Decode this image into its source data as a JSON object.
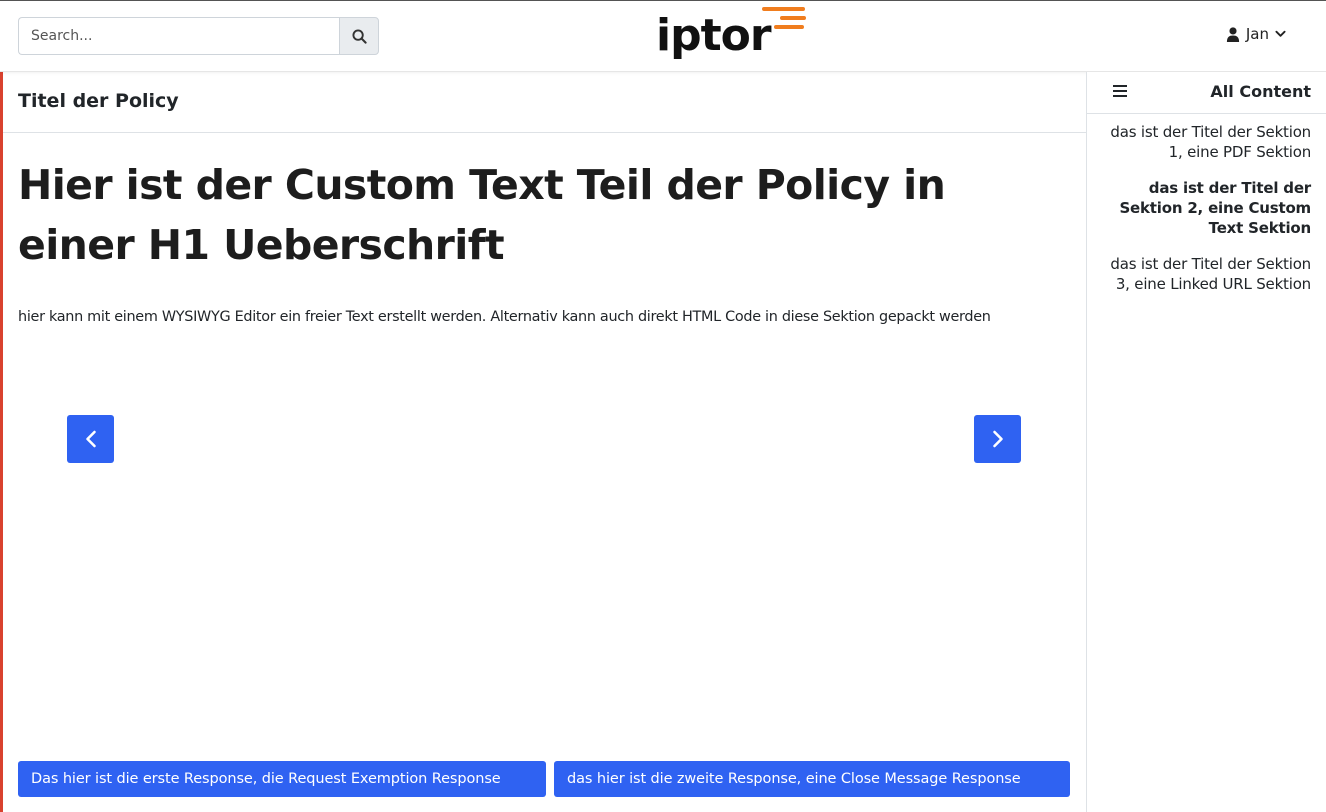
{
  "header": {
    "search_placeholder": "Search...",
    "logo_text": "iptor",
    "user_name": "Jan"
  },
  "main": {
    "policy_title": "Titel der Policy",
    "heading": "Hier ist der Custom Text Teil der Policy in einer H1 Ueberschrift",
    "body": "hier kann mit einem WYSIWYG Editor ein freier Text erstellt werden. Alternativ kann auch direkt HTML Code in diese Sektion gepackt werden",
    "responses": [
      "Das hier ist die erste Response, die Request Exemption Response",
      "das hier ist die zweite Response, eine Close Message Response"
    ]
  },
  "sidebar": {
    "title": "All Content",
    "items": [
      "das ist der Titel der Sektion 1, eine PDF Sektion",
      "das ist der Titel der Sektion 2, eine Custom Text Sektion",
      "das ist der Titel der Sektion 3, eine Linked URL Sektion"
    ],
    "active_index": 1
  },
  "colors": {
    "primary": "#2f62f2",
    "logo_accent": "#f07d1e",
    "left_accent": "#d9412e"
  },
  "icons": [
    "search-icon",
    "user-icon",
    "chevron-down-icon",
    "chevron-left-icon",
    "chevron-right-icon",
    "menu-icon"
  ]
}
